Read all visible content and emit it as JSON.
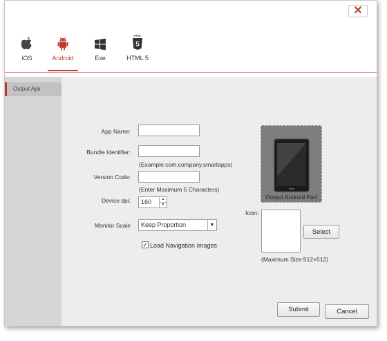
{
  "tabs": [
    {
      "label": "iOS",
      "icon": "apple-icon"
    },
    {
      "label": "Android",
      "icon": "android-icon",
      "active": true
    },
    {
      "label": "Exe",
      "icon": "windows-icon"
    },
    {
      "label": "HTML 5",
      "icon": "html5-icon"
    }
  ],
  "sidebar": {
    "items": [
      {
        "label": "Output Apk"
      }
    ]
  },
  "form": {
    "app_name_label": "App Name:",
    "app_name_value": "",
    "bundle_label": "Bundle Identifier:",
    "bundle_value": "",
    "bundle_hint": "(Example:com.company.smartapps)",
    "version_label": "Version Code:",
    "version_value": "",
    "version_hint": "(Enter Maximum 5 Characters)",
    "dpi_label": "Device dpi:",
    "dpi_value": "160",
    "monitor_label": "Monitor Scale",
    "monitor_value": "Keep Proportion",
    "nav_images_label": "Load Navigation Images",
    "nav_images_checked": true
  },
  "preview": {
    "label": "Output Android Pad"
  },
  "icon": {
    "label": "Icon:",
    "select_button": "Select",
    "hint": "(Maximum Size:512×512)"
  },
  "footer": {
    "submit": "Submit",
    "cancel": "Cancel"
  },
  "colors": {
    "accent": "#c0392b",
    "sidebar": "#d6d6d6",
    "main": "#ededed"
  }
}
